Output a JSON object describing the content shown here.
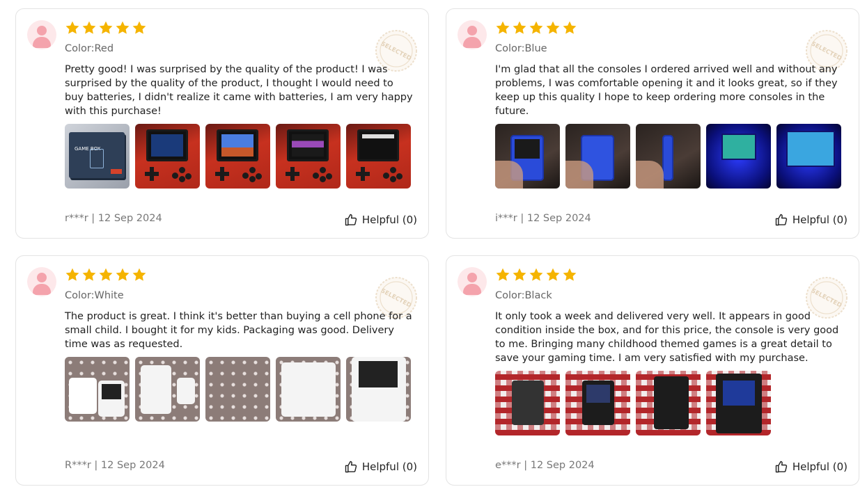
{
  "colors": {
    "star": "#f5b400",
    "card_border": "#e3e3e3",
    "avatar_bg": "#fde8ea",
    "avatar_fg": "#f4a3ac",
    "stamp": "#e6d3b8"
  },
  "icons": {
    "star": "star-icon",
    "thumbs_up": "thumbs-up-icon",
    "avatar": "user-avatar-icon",
    "stamp": "selected-stamp-icon"
  },
  "reviews": [
    {
      "rating": 5,
      "variant": "Color:Red",
      "stamp": "SELECTED",
      "text": "Pretty good! I was surprised by the quality of the product! I was surprised by the quality of the product, I thought I would need to buy batteries, I didn't realize it came with batteries, I am very happy with this purchase!",
      "author": "r***r",
      "date": "12 Sep 2024",
      "meta": "r***r | 12 Sep 2024",
      "helpful": "Helpful (0)",
      "photo_count": 5
    },
    {
      "rating": 5,
      "variant": "Color:Blue",
      "stamp": "SELECTED",
      "text": "I'm glad that all the consoles I ordered arrived well and without any problems, I was comfortable opening it and it looks great, so if they keep up this quality I hope to keep ordering more consoles in the future.",
      "author": "i***r",
      "date": "12 Sep 2024",
      "meta": "i***r | 12 Sep 2024",
      "helpful": "Helpful (0)",
      "photo_count": 5
    },
    {
      "rating": 5,
      "variant": "Color:White",
      "stamp": "SELECTED",
      "text": "The product is great. I think it's better than buying a cell phone for a small child. I bought it for my kids. Packaging was good. Delivery time was as requested.",
      "author": "R***r",
      "date": "12 Sep 2024",
      "meta": "R***r | 12 Sep 2024",
      "helpful": "Helpful (0)",
      "photo_count": 5
    },
    {
      "rating": 5,
      "variant": "Color:Black",
      "stamp": "SELECTED",
      "text": "It only took a week and delivered very well. It appears in good condition inside the box, and for this price, the console is very good to me. Bringing many childhood themed games is a great detail to save your gaming time. I am very satisfied with my purchase.",
      "author": "e***r",
      "date": "12 Sep 2024",
      "meta": "e***r | 12 Sep 2024",
      "helpful": "Helpful (0)",
      "photo_count": 4
    }
  ]
}
